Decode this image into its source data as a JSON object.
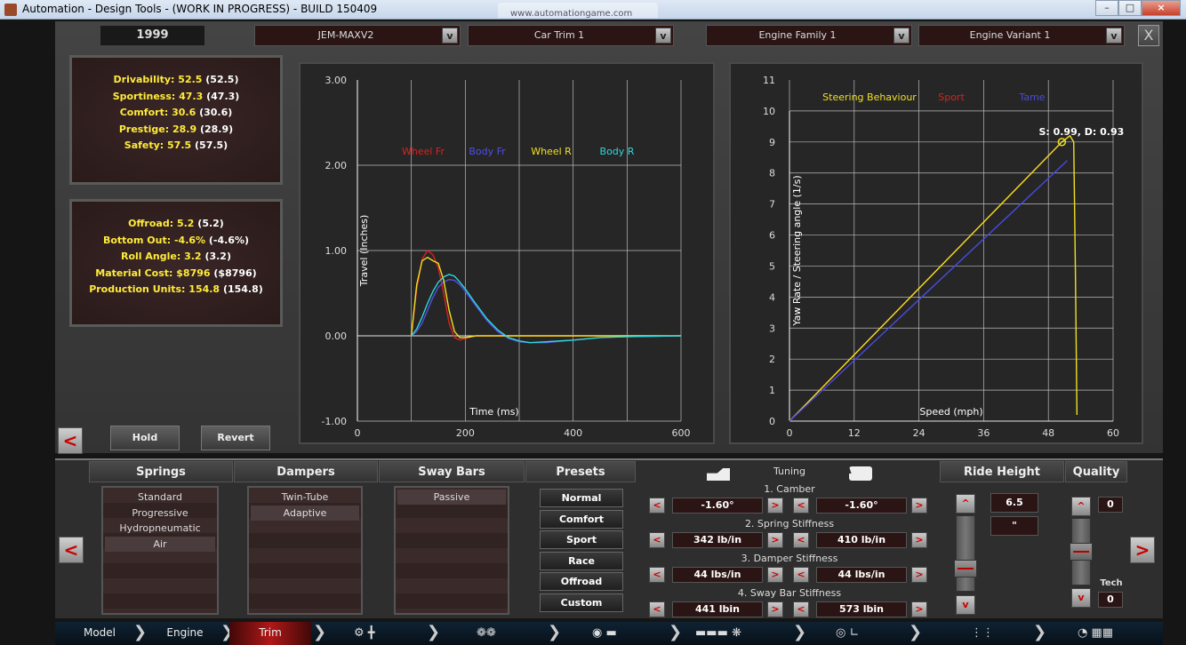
{
  "window": {
    "title": "Automation - Design Tools - (WORK IN PROGRESS) - BUILD 150409",
    "ghost_tab": "www.automationgame.com"
  },
  "topbar": {
    "year": "1999",
    "model": "JEM-MAXV2",
    "trim": "Car Trim 1",
    "engine_family": "Engine Family 1",
    "engine_variant": "Engine Variant 1",
    "dropdown_glyph": "v",
    "close_glyph": "X"
  },
  "stats1": [
    {
      "label": "Drivability:",
      "value": "52.5",
      "prev": "(52.5)"
    },
    {
      "label": "Sportiness:",
      "value": "47.3",
      "prev": "(47.3)"
    },
    {
      "label": "Comfort:",
      "value": "30.6",
      "prev": "(30.6)"
    },
    {
      "label": "Prestige:",
      "value": "28.9",
      "prev": "(28.9)"
    },
    {
      "label": "Safety:",
      "value": "57.5",
      "prev": "(57.5)"
    }
  ],
  "stats2": [
    {
      "label": "Offroad:",
      "value": "5.2",
      "prev": "(5.2)"
    },
    {
      "label": "Bottom Out:",
      "value": "-4.6%",
      "prev": "(-4.6%)"
    },
    {
      "label": "Roll Angle:",
      "value": "3.2",
      "prev": "(3.2)"
    },
    {
      "label": "Material Cost:",
      "value": "$8796",
      "prev": "($8796)"
    },
    {
      "label": "Production Units:",
      "value": "154.8",
      "prev": "(154.8)"
    }
  ],
  "buttons": {
    "hold": "Hold",
    "revert": "Revert",
    "left_arrow": "<",
    "right_arrow": ">"
  },
  "chart_data": [
    {
      "type": "line",
      "xlabel": "Time (ms)",
      "ylabel": "Travel (Inches)",
      "xlim": [
        0,
        600
      ],
      "ylim": [
        -1,
        3
      ],
      "x_ticks": [
        "0",
        "200",
        "400",
        "600"
      ],
      "y_ticks": [
        "-1.00",
        "0.00",
        "1.00",
        "2.00",
        "3.00"
      ],
      "grid": true,
      "legend_placement": "top-center",
      "series": [
        {
          "name": "Wheel Fr",
          "color": "#dd2020",
          "x": [
            100,
            110,
            120,
            130,
            140,
            150,
            160,
            170,
            180,
            190,
            200,
            220,
            240,
            260,
            300,
            350,
            400,
            450,
            500,
            600
          ],
          "y": [
            0,
            0.55,
            0.9,
            1.0,
            0.95,
            0.8,
            0.5,
            0.15,
            -0.02,
            -0.05,
            -0.03,
            0,
            0,
            0,
            0,
            0,
            0,
            0,
            0,
            0
          ]
        },
        {
          "name": "Body Fr",
          "color": "#5050e8",
          "x": [
            100,
            110,
            120,
            130,
            140,
            150,
            160,
            170,
            180,
            190,
            200,
            220,
            240,
            260,
            280,
            300,
            320,
            350,
            400,
            450,
            500,
            600
          ],
          "y": [
            0,
            0.05,
            0.15,
            0.3,
            0.45,
            0.57,
            0.63,
            0.66,
            0.65,
            0.6,
            0.52,
            0.35,
            0.18,
            0.05,
            -0.03,
            -0.07,
            -0.08,
            -0.08,
            -0.05,
            -0.02,
            -0.01,
            0
          ]
        },
        {
          "name": "Wheel R",
          "color": "#f0e020",
          "x": [
            100,
            110,
            120,
            130,
            140,
            150,
            160,
            170,
            180,
            190,
            200,
            220,
            240,
            260,
            300,
            350,
            400,
            450,
            500,
            600
          ],
          "y": [
            0,
            0.6,
            0.88,
            0.92,
            0.88,
            0.85,
            0.65,
            0.3,
            0.05,
            -0.02,
            -0.02,
            0,
            0,
            0,
            0,
            0,
            0,
            0,
            0,
            0
          ]
        },
        {
          "name": "Body R",
          "color": "#30d8d8",
          "x": [
            100,
            110,
            120,
            130,
            140,
            150,
            160,
            170,
            180,
            190,
            200,
            220,
            240,
            260,
            280,
            300,
            320,
            350,
            400,
            450,
            500,
            600
          ],
          "y": [
            0,
            0.08,
            0.22,
            0.38,
            0.52,
            0.63,
            0.69,
            0.72,
            0.7,
            0.63,
            0.55,
            0.37,
            0.2,
            0.07,
            -0.02,
            -0.06,
            -0.08,
            -0.07,
            -0.05,
            -0.02,
            -0.01,
            0
          ]
        }
      ]
    },
    {
      "type": "line",
      "xlabel": "Speed (mph)",
      "ylabel": "Yaw Rate / Steering angle (1/s)",
      "xlim": [
        0,
        60
      ],
      "ylim": [
        0,
        11
      ],
      "x_ticks": [
        "0",
        "12",
        "24",
        "36",
        "48",
        "60"
      ],
      "y_ticks": [
        "0",
        "1",
        "2",
        "3",
        "4",
        "5",
        "6",
        "7",
        "8",
        "9",
        "10",
        "11"
      ],
      "grid": true,
      "legend_placement": "top",
      "legend_title": "Steering Behaviour",
      "annotation": {
        "text": "S: 0.99, D: 0.93",
        "x": 50.5,
        "y": 9.0
      },
      "series": [
        {
          "name": "Sport",
          "color": "#dd2020",
          "x": [
            0,
            50.5
          ],
          "y": [
            0,
            9.0
          ]
        },
        {
          "name": "",
          "color": "#f0e020",
          "x": [
            0,
            50.5,
            52.0,
            52.7,
            53.0,
            53.3
          ],
          "y": [
            0,
            9.0,
            9.2,
            9.0,
            5.0,
            0.2
          ]
        },
        {
          "name": "Tame",
          "color": "#4a4ae0",
          "x": [
            0,
            51.5
          ],
          "y": [
            0,
            8.4
          ]
        }
      ]
    }
  ],
  "bottom": {
    "headers": {
      "springs": "Springs",
      "dampers": "Dampers",
      "sway_bars": "Sway Bars",
      "presets": "Presets",
      "tuning": "Tuning",
      "ride_height": "Ride Height",
      "quality": "Quality"
    },
    "springs": [
      "Standard",
      "Progressive",
      "Hydropneumatic",
      "Air"
    ],
    "springs_selected": 3,
    "dampers": [
      "Twin-Tube",
      "Adaptive"
    ],
    "dampers_selected": 1,
    "sway_bars": [
      "Passive"
    ],
    "sway_selected": 0,
    "presets": [
      "Normal",
      "Comfort",
      "Sport",
      "Race",
      "Offroad",
      "Custom"
    ],
    "tuning": [
      {
        "label": "1. Camber",
        "front": "-1.60°",
        "rear": "-1.60°"
      },
      {
        "label": "2. Spring Stiffness",
        "front": "342 lb/in",
        "rear": "410 lb/in"
      },
      {
        "label": "3. Damper Stiffness",
        "front": "44 lbs/in",
        "rear": "44 lbs/in"
      },
      {
        "label": "4. Sway Bar Stiffness",
        "front": "441 lbin",
        "rear": "573 lbin"
      }
    ],
    "ride_height": {
      "value": "6.5",
      "unit": "\"",
      "level": 0.25
    },
    "quality": {
      "value": "0",
      "tech_label": "Tech",
      "tech_value": "0",
      "level": 0.5
    },
    "arrow_left": "<",
    "arrow_right": ">",
    "arrow_up": "^",
    "arrow_down": "v"
  },
  "nav": {
    "model": "Model",
    "engine": "Engine",
    "trim": "Trim"
  }
}
